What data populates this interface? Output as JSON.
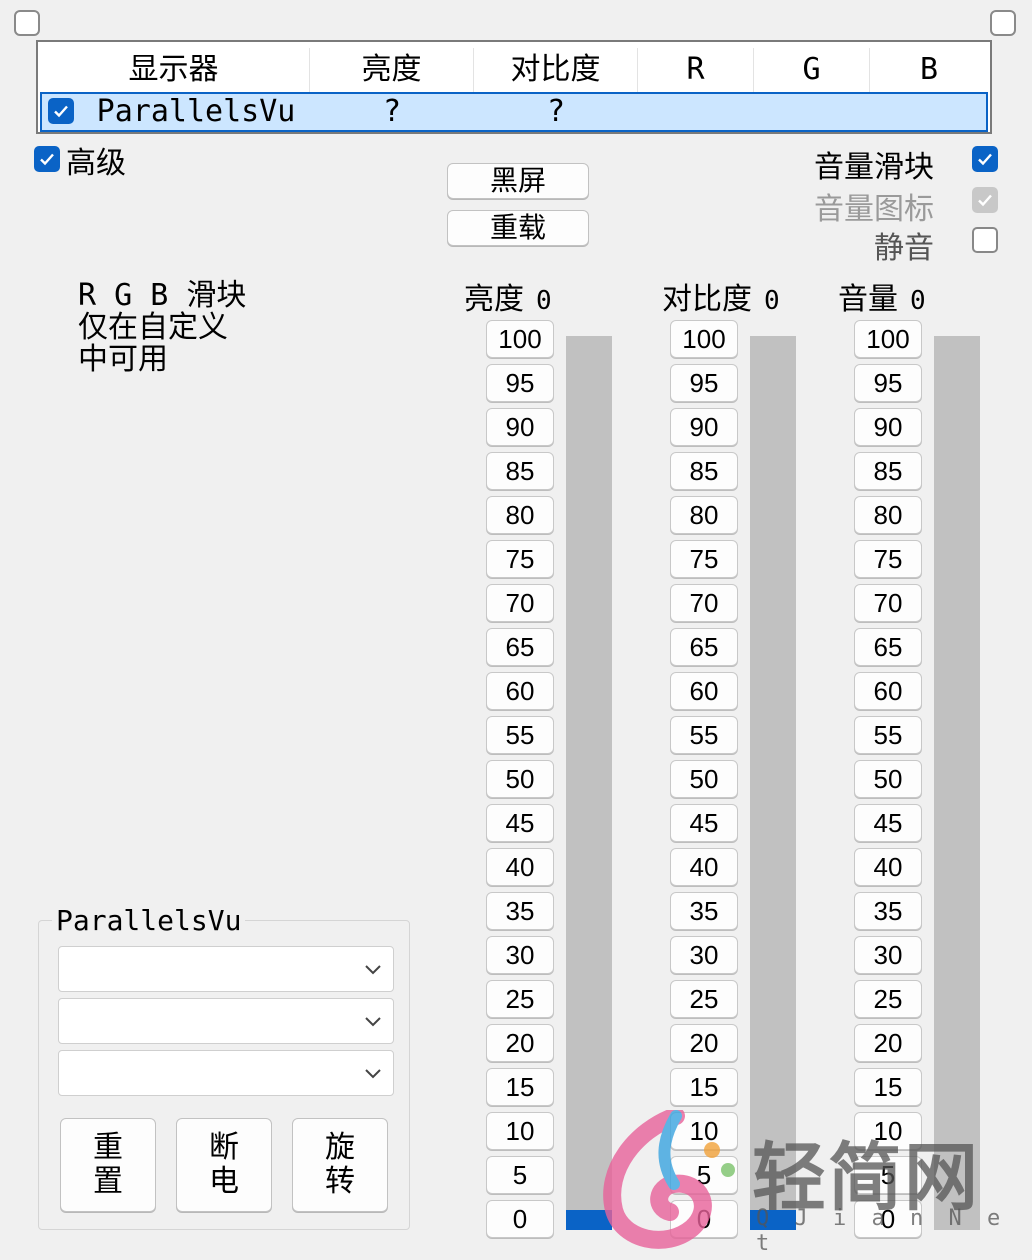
{
  "monitor_table": {
    "headers": [
      "显示器",
      "亮度",
      "对比度",
      "R",
      "G",
      "B"
    ],
    "row": {
      "name": "ParallelsVu",
      "brightness": "?",
      "contrast": "?",
      "r": "",
      "g": "",
      "b": ""
    }
  },
  "advanced_label": "高级",
  "buttons": {
    "blackscreen": "黑屏",
    "reload": "重载"
  },
  "options": {
    "volume_slider": "音量滑块",
    "volume_icon": "音量图标",
    "mute": "静音"
  },
  "rgb_note": [
    "R G B 滑块",
    "仅在自定义",
    "中可用"
  ],
  "sliders": [
    {
      "label": "亮度",
      "value": "0"
    },
    {
      "label": "对比度",
      "value": "0"
    },
    {
      "label": "音量",
      "value": "0"
    }
  ],
  "ticks": [
    "100",
    "95",
    "90",
    "85",
    "80",
    "75",
    "70",
    "65",
    "60",
    "55",
    "50",
    "45",
    "40",
    "35",
    "30",
    "25",
    "20",
    "15",
    "10",
    "5",
    "0"
  ],
  "slider_levels": [
    0,
    0,
    0
  ],
  "group": {
    "title": "ParallelsVu",
    "combos": [
      "",
      "",
      ""
    ],
    "buttons": [
      {
        "line1": "重",
        "line2": "置"
      },
      {
        "line1": "断",
        "line2": "电"
      },
      {
        "line1": "旋",
        "line2": "转"
      }
    ]
  },
  "watermark": {
    "text": "轻简网",
    "sub": "Q J i a n N e t"
  },
  "colors": {
    "accent": "#0a63c6",
    "track": "#c1c1c1",
    "selection": "#cce6ff"
  }
}
